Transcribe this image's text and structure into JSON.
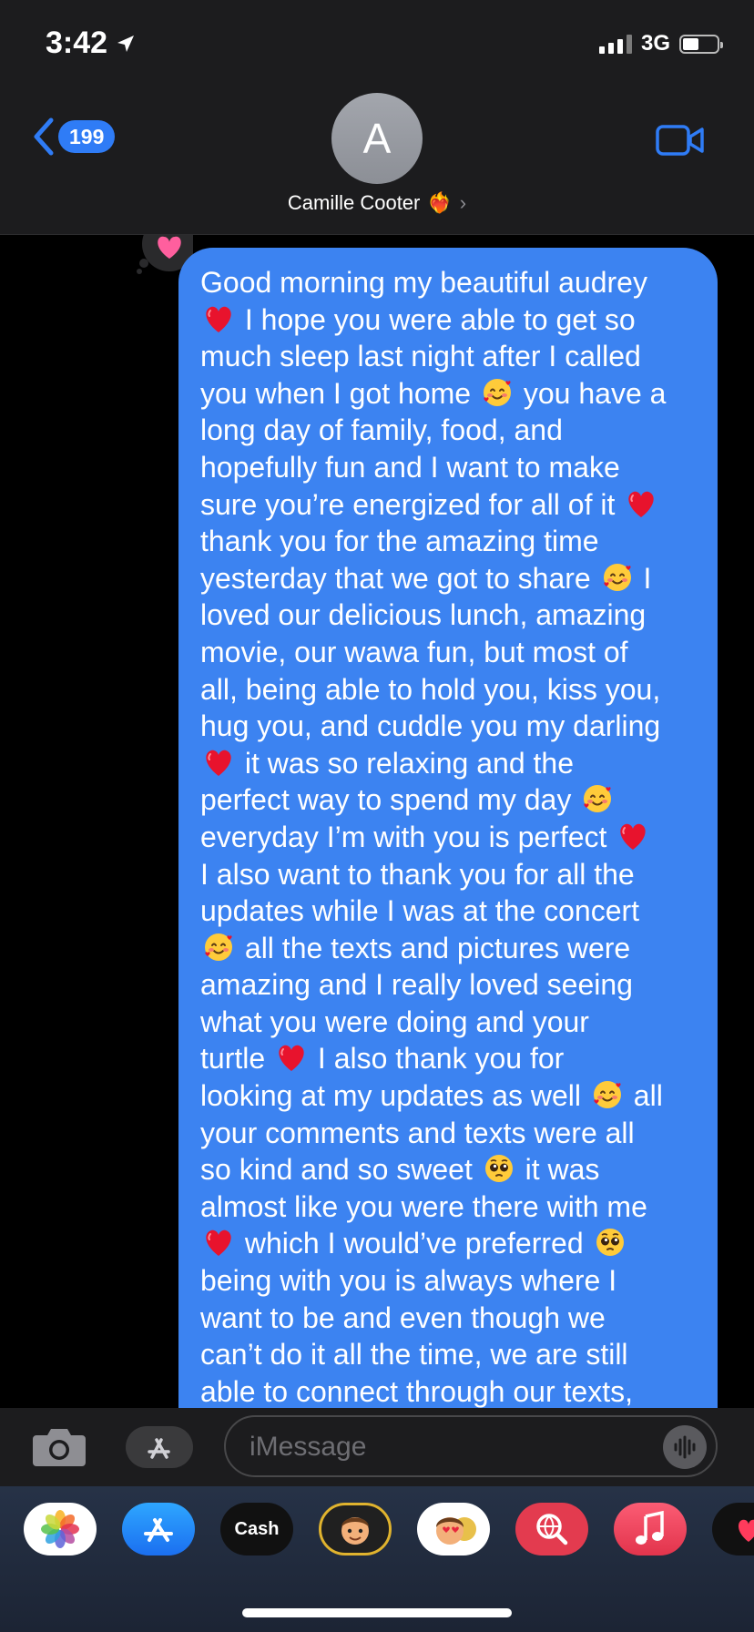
{
  "status_bar": {
    "time": "3:42",
    "network": "3G"
  },
  "header": {
    "back_count": "199",
    "avatar_initial": "A",
    "contact_name": "Camille Cooter",
    "contact_emoji": "❤️‍🔥"
  },
  "message": {
    "lines": [
      "Good morning my beautiful audrey",
      "[heart] I hope you were able to get so",
      "much sleep last night after I called",
      "you when I got home [smile] you have a",
      "long day of family, food, and",
      "hopefully fun and I want to make",
      "sure you’re energized for all of it [heart]",
      "thank you for the amazing time",
      "yesterday that we got to share [smile] I",
      "loved our delicious lunch, amazing",
      "movie, our wawa fun, but most of",
      "all, being able to hold you, kiss you,",
      "hug you, and cuddle you my darling",
      "[heart] it was so relaxing and the",
      "perfect way to spend my day [smile]",
      "everyday I’m with you is perfect [heart]",
      "I also want to thank you for all the",
      "updates while I was at the concert",
      "[smile] all the texts and pictures were",
      "amazing and I really loved seeing",
      "what you were doing and your",
      "turtle [heart] I also thank you for",
      "looking at my updates as well [smile] all",
      "your comments and texts were all",
      "so kind and so sweet [plead] it was",
      "almost like you were there with me",
      "[heart] which I would’ve preferred [plead]",
      "being with you is always where I",
      "want to be and even though we",
      "can’t do it all the time, we are still",
      "able to connect through our texts,"
    ],
    "emoji_legend": {
      "heart": "red-heart-emoji",
      "smile": "smiling-face-with-hearts-emoji",
      "plead": "pleading-face-emoji"
    }
  },
  "input": {
    "placeholder": "iMessage"
  },
  "apps": [
    {
      "name": "photos-app-icon"
    },
    {
      "name": "app-store-icon"
    },
    {
      "name": "apple-cash-icon",
      "label": "Cash"
    },
    {
      "name": "memoji-icon"
    },
    {
      "name": "memoji-stickers-icon"
    },
    {
      "name": "image-search-icon"
    },
    {
      "name": "music-icon"
    },
    {
      "name": "digital-touch-icon"
    }
  ],
  "colors": {
    "bubble": "#3c83f1",
    "accent_blue": "#2f7cf6",
    "header_bg": "#1c1c1e",
    "drawer_bg": "#263247"
  }
}
